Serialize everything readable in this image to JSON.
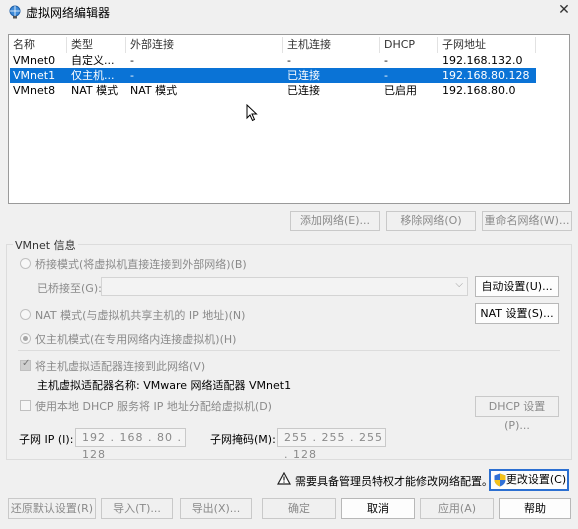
{
  "window": {
    "title": "虚拟网络编辑器"
  },
  "table": {
    "headers": [
      "名称",
      "类型",
      "外部连接",
      "主机连接",
      "DHCP",
      "子网地址"
    ],
    "rows": [
      [
        "VMnet0",
        "自定义...",
        "-",
        "-",
        "-",
        "192.168.132.0"
      ],
      [
        "VMnet1",
        "仅主机...",
        "-",
        "已连接",
        "-",
        "192.168.80.128"
      ],
      [
        "VMnet8",
        "NAT 模式",
        "NAT 模式",
        "已连接",
        "已启用",
        "192.168.80.0"
      ]
    ],
    "selected_row": 1
  },
  "list_buttons": {
    "add": "添加网络(E)...",
    "remove": "移除网络(O)",
    "rename": "重命名网络(W)..."
  },
  "vmnet_info": {
    "title": "VMnet 信息",
    "bridged_label": "桥接模式(将虚拟机直接连接到外部网络)(B)",
    "bridged_to_label": "已桥接至(G):",
    "auto_settings": "自动设置(U)...",
    "nat_label": "NAT 模式(与虚拟机共享主机的 IP 地址)(N)",
    "nat_settings": "NAT 设置(S)...",
    "hostonly_label": "仅主机模式(在专用网络内连接虚拟机)(H)",
    "connect_adapter_label": "将主机虚拟适配器连接到此网络(V)",
    "adapter_name": "主机虚拟适配器名称: VMware 网络适配器 VMnet1",
    "dhcp_label": "使用本地 DHCP 服务将 IP 地址分配给虚拟机(D)",
    "dhcp_settings": "DHCP 设置(P)...",
    "subnet_ip_label": "子网 IP (I):",
    "subnet_ip": "192 . 168 . 80 . 128",
    "subnet_mask_label": "子网掩码(M):",
    "subnet_mask": "255 . 255 . 255 . 128"
  },
  "admin": {
    "warning": "需要具备管理员特权才能修改网络配置。",
    "change_settings": "更改设置(C)"
  },
  "footer": {
    "restore_defaults": "还原默认设置(R)",
    "import": "导入(T)...",
    "export": "导出(X)...",
    "ok": "确定",
    "cancel": "取消",
    "apply": "应用(A)",
    "help": "帮助"
  },
  "colors": {
    "selection": "#0a73d6",
    "default_button_border": "#2b6fd1"
  }
}
